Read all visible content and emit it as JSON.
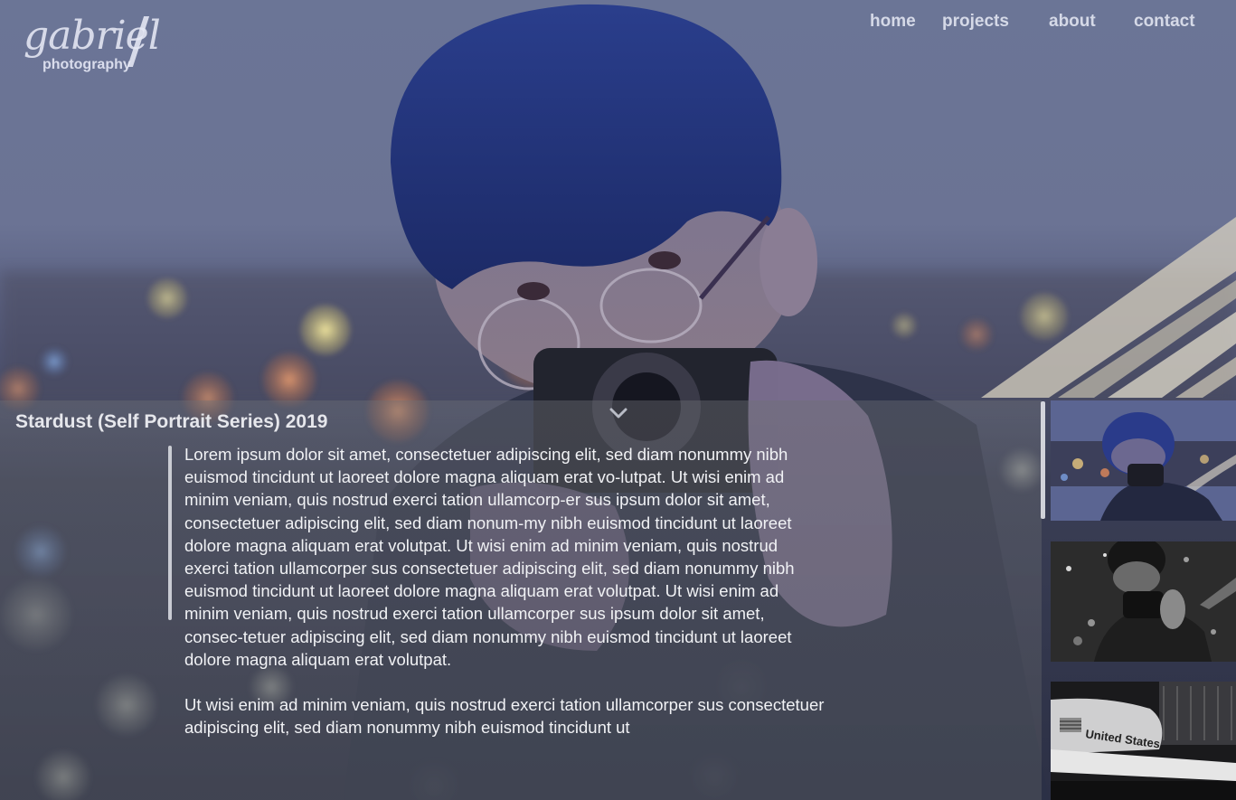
{
  "logo": {
    "script": "gabriel",
    "subtitle": "photography"
  },
  "nav": {
    "items": [
      {
        "label": "home"
      },
      {
        "label": "projects"
      },
      {
        "label": "about"
      },
      {
        "label": "contact"
      }
    ]
  },
  "project": {
    "title": "Stardust (Self Portrait Series) 2019",
    "paragraphs": [
      "Lorem ipsum dolor sit amet, consectetuer adipiscing elit, sed diam nonummy nibh euismod tincidunt ut laoreet dolore magna aliquam erat vo-lutpat. Ut wisi enim ad minim veniam, quis nostrud exerci tation ullamcorp-er sus ipsum dolor sit amet, consectetuer adipiscing elit, sed diam nonum-my nibh euismod tincidunt ut laoreet dolore magna aliquam erat volutpat. Ut wisi enim ad minim veniam, quis nostrud exerci tation ullamcorper sus consectetuer adipiscing elit, sed diam nonummy nibh euismod tincidunt ut laoreet dolore magna aliquam erat volutpat. Ut wisi enim ad minim veniam, quis nostrud exerci tation ullamcorper sus ipsum dolor sit amet, consec-tetuer adipiscing elit, sed diam nonummy nibh euismod tincidunt ut laoreet dolore magna aliquam erat volutpat.",
      "Ut wisi enim ad minim veniam, quis nostrud exerci tation ullamcorper sus consectetuer adipiscing elit, sed diam nonummy nibh euismod tincidunt ut"
    ]
  },
  "thumbnails": [
    {
      "name": "self-portrait-color"
    },
    {
      "name": "self-portrait-bw"
    },
    {
      "name": "space-shuttle"
    }
  ],
  "icons": {
    "scroll_down": "chevron-down-icon"
  },
  "colors": {
    "nav_text": "#e4e7f3",
    "panel_text": "#f1f2f5",
    "title_text": "#e6e7ec"
  }
}
